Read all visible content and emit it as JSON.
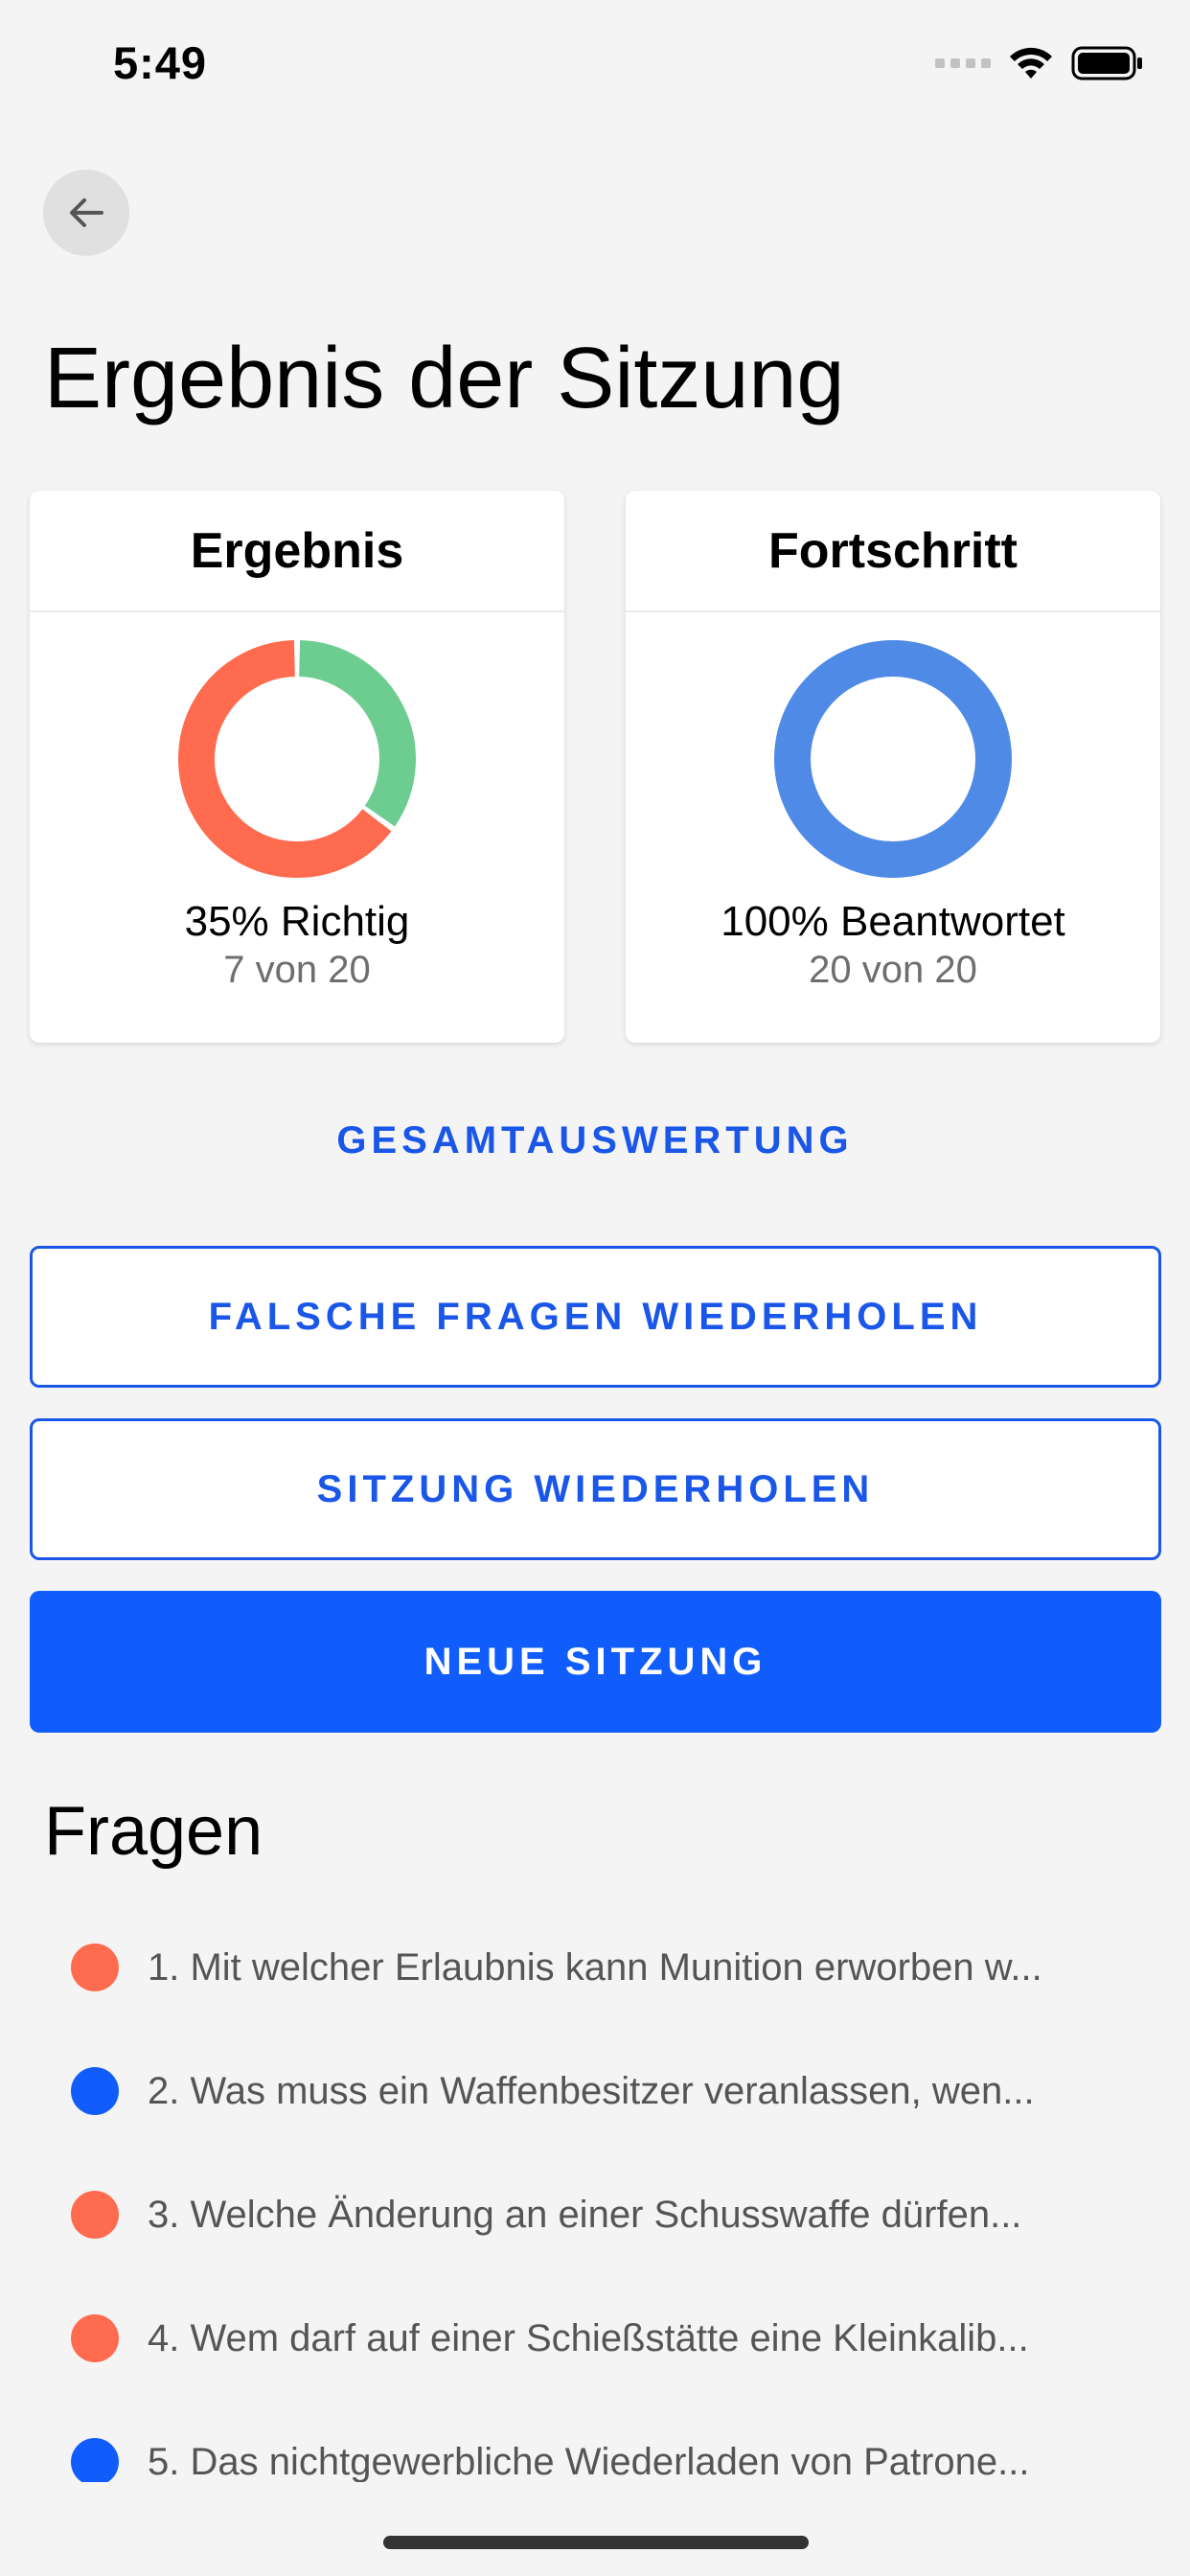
{
  "status_bar": {
    "time": "5:49"
  },
  "header": {
    "title": "Ergebnis der Sitzung"
  },
  "result_card": {
    "title": "Ergebnis",
    "main": "35% Richtig",
    "sub": "7 von 20",
    "correct_fraction": 0.35,
    "colors": {
      "correct": "#6dcc8f",
      "wrong": "#ff6b4f"
    }
  },
  "progress_card": {
    "title": "Fortschritt",
    "main": "100% Beantwortet",
    "sub": "20 von 20",
    "answered_fraction": 1.0,
    "colors": {
      "answered": "#4f8ae6"
    }
  },
  "actions": {
    "overall_link": "GESAMTAUSWERTUNG",
    "retry_wrong": "FALSCHE FRAGEN WIEDERHOLEN",
    "retry_session": "SITZUNG WIEDERHOLEN",
    "new_session": "NEUE SITZUNG"
  },
  "questions": {
    "title": "Fragen",
    "items": [
      {
        "text": "1. Mit welcher Erlaubnis kann Munition erworben w...",
        "color": "#ff6b4f"
      },
      {
        "text": "2. Was muss ein Waffenbesitzer veranlassen, wen...",
        "color": "#115dfb"
      },
      {
        "text": "3. Welche Änderung an einer Schusswaffe dürfen...",
        "color": "#ff6b4f"
      },
      {
        "text": "4. Wem darf auf einer Schießstätte eine Kleinkalib...",
        "color": "#ff6b4f"
      },
      {
        "text": "5. Das nichtgewerbliche Wiederladen von Patrone...",
        "color": "#115dfb"
      }
    ]
  },
  "theme": {
    "accent": "#1a56e8",
    "primary_button": "#115dfb",
    "background": "#f4f4f4"
  }
}
